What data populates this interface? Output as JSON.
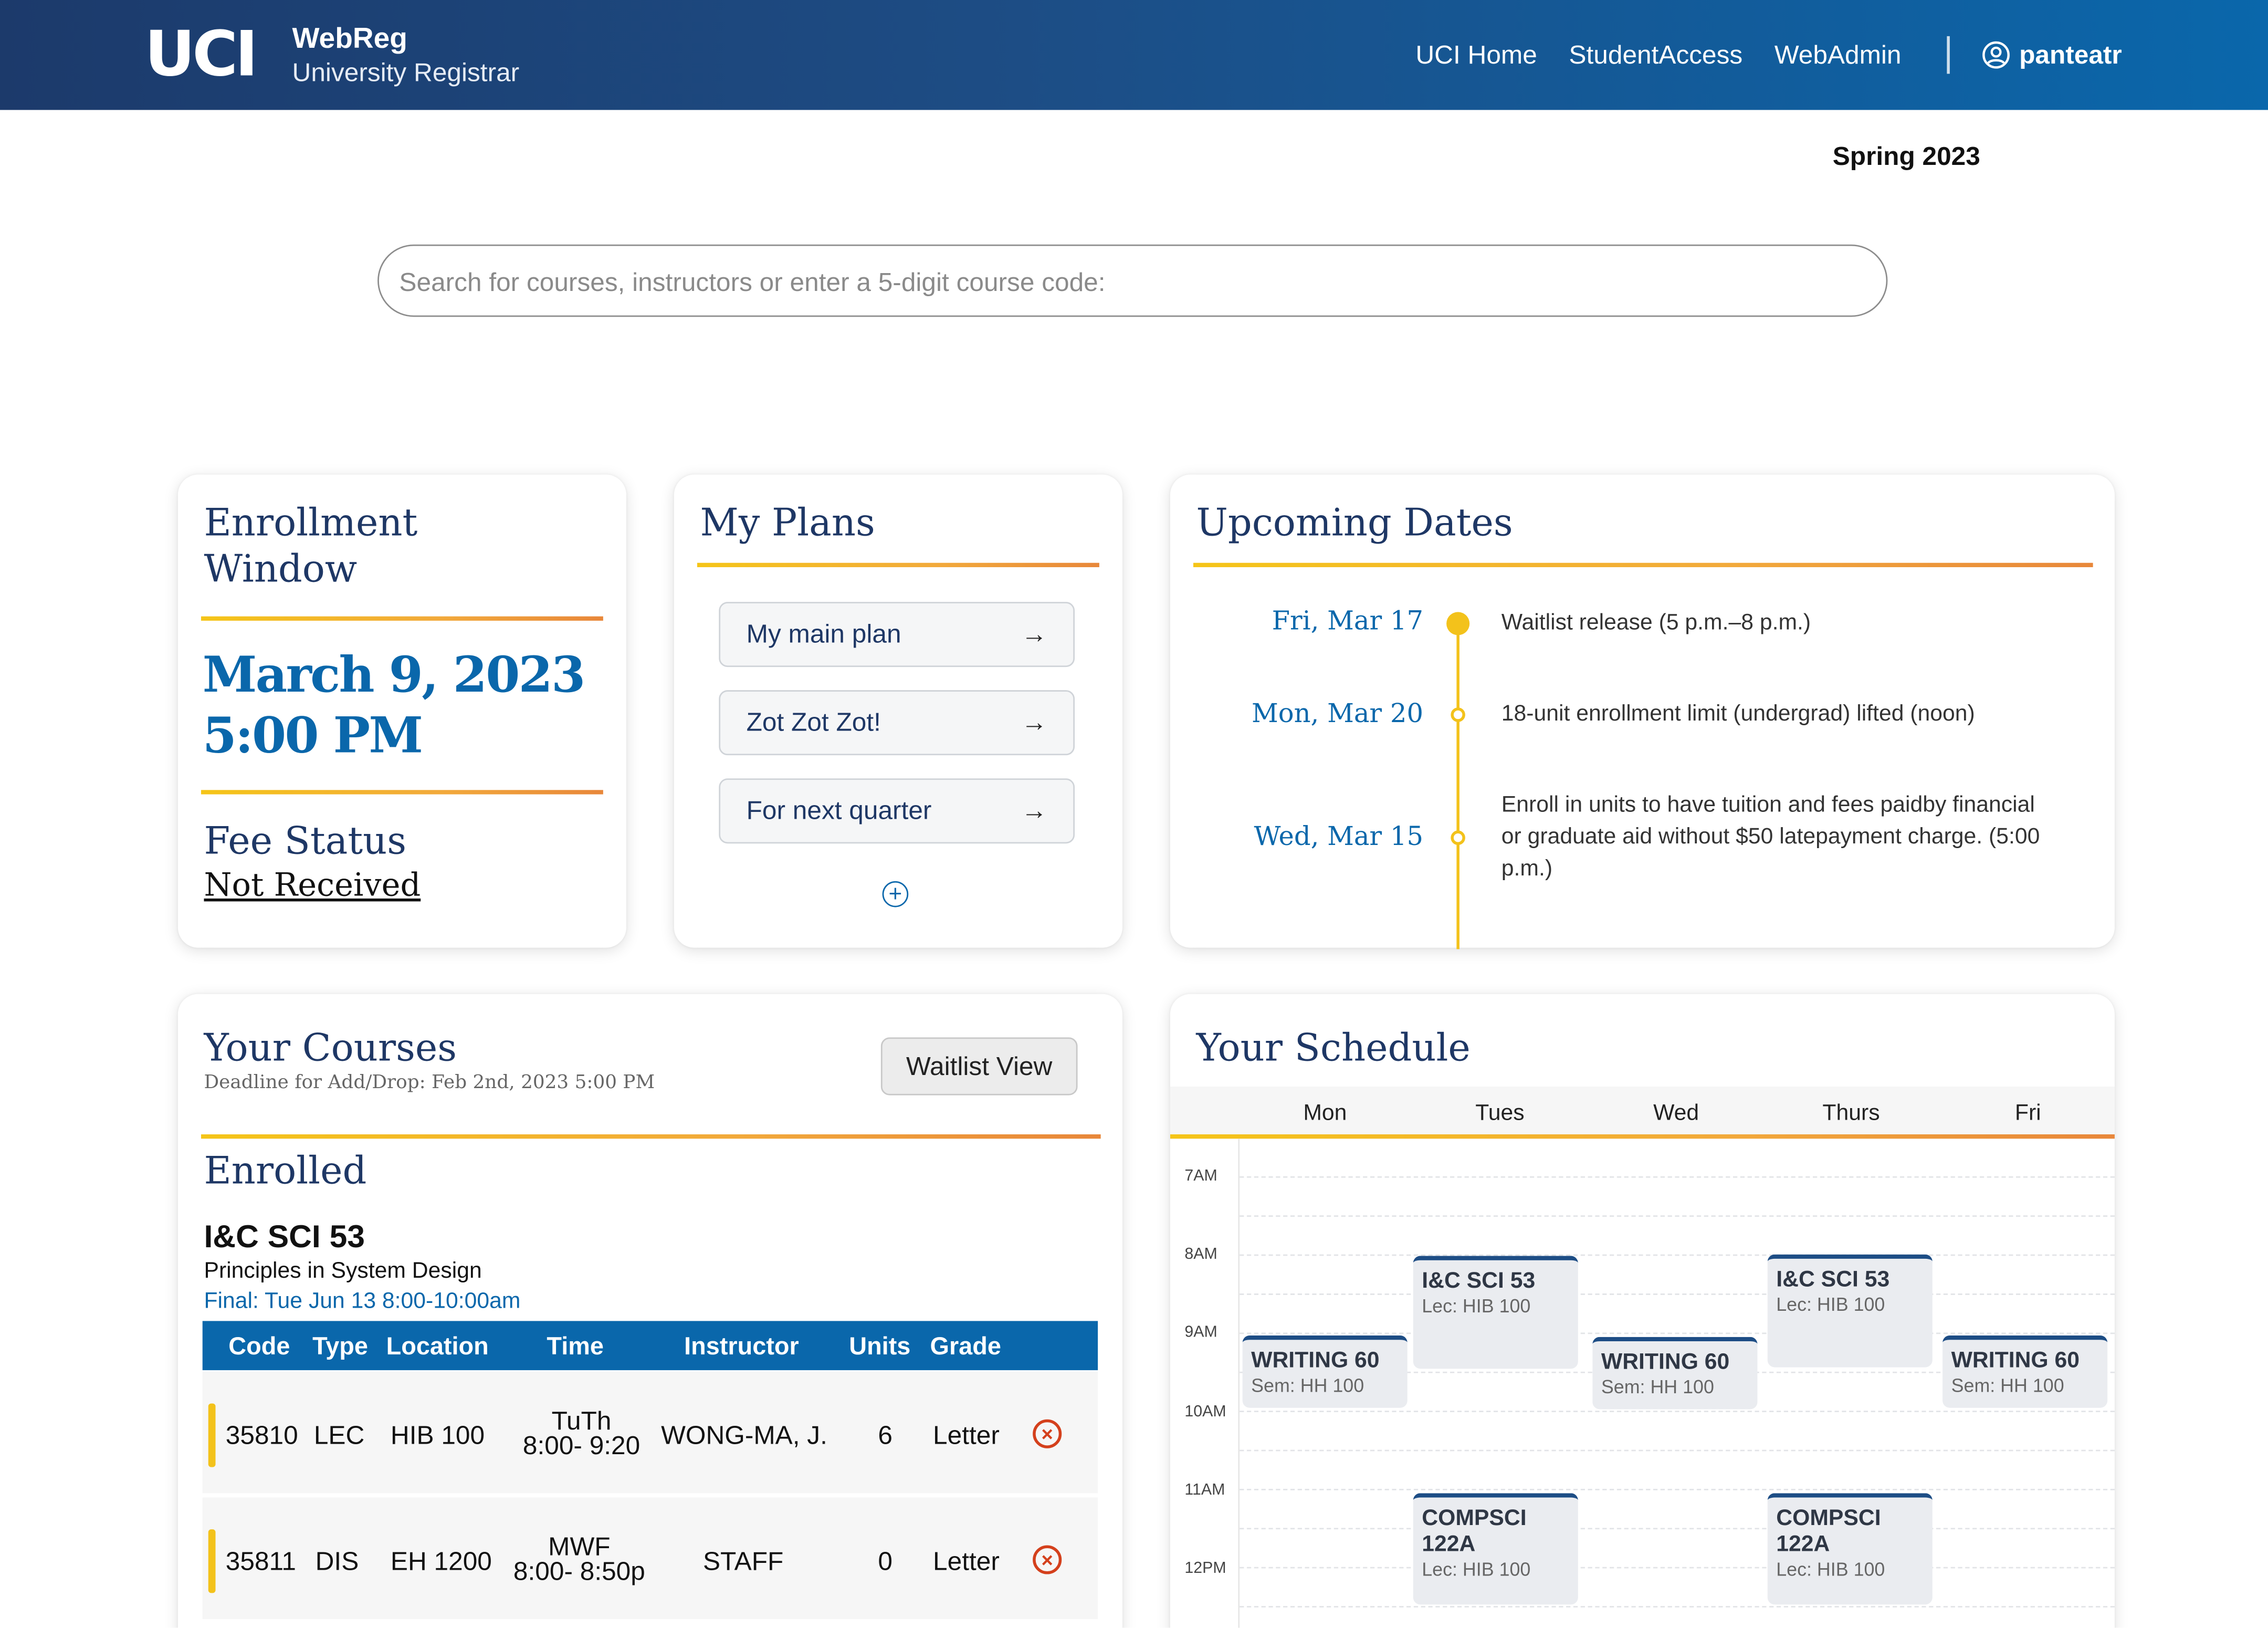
{
  "header": {
    "logo": "UCI",
    "brand_title": "WebReg",
    "brand_sub": "University Registrar",
    "nav": [
      "UCI Home",
      "StudentAccess",
      "WebAdmin"
    ],
    "user": "panteatr"
  },
  "term": "Spring 2023",
  "search": {
    "placeholder": "Search for courses, instructors or enter a 5-digit course code:"
  },
  "enrollment": {
    "title": "Enrollment Window",
    "date": "March 9, 2023",
    "time": "5:00 PM",
    "fee_title": "Fee Status",
    "fee_status": "Not Received"
  },
  "plans": {
    "title": "My Plans",
    "items": [
      {
        "label": "My main plan"
      },
      {
        "label": "Zot Zot Zot!"
      },
      {
        "label": "For next quarter"
      }
    ]
  },
  "upcoming": {
    "title": "Upcoming Dates",
    "items": [
      {
        "date": "Fri, Mar 17",
        "text": "Waitlist release (5 p.m.–8 p.m.)"
      },
      {
        "date": "Mon, Mar 20",
        "text": "18-unit enrollment limit (undergrad) lifted (noon)"
      },
      {
        "date": "Wed, Mar 15",
        "text": "Enroll in units to have tuition and fees paidby financial or graduate aid without $50 latepayment charge. (5:00 p.m.)"
      }
    ]
  },
  "courses": {
    "title": "Your Courses",
    "deadline": "Deadline for Add/Drop: Feb 2nd, 2023 5:00 PM",
    "waitlist_button": "Waitlist View",
    "section_title": "Enrolled",
    "course": {
      "code": "I&C SCI 53",
      "name": "Principles in System Design",
      "final": "Final: Tue Jun 13 8:00-10:00am"
    },
    "columns": [
      "Code",
      "Type",
      "Location",
      "Time",
      "Instructor",
      "Units",
      "Grade"
    ],
    "rows": [
      {
        "code": "35810",
        "type": "LEC",
        "location": "HIB 100",
        "days": "TuTh",
        "time": "8:00- 9:20",
        "instructor": "WONG-MA, J.",
        "units": "6",
        "grade": "Letter"
      },
      {
        "code": "35811",
        "type": "DIS",
        "location": "EH 1200",
        "days": "MWF",
        "time": "8:00- 8:50p",
        "instructor": "STAFF",
        "units": "0",
        "grade": "Letter"
      }
    ]
  },
  "schedule": {
    "title": "Your Schedule",
    "days": [
      "Mon",
      "Tues",
      "Wed",
      "Thurs",
      "Fri"
    ],
    "hours": [
      "7AM",
      "8AM",
      "9AM",
      "10AM",
      "11AM",
      "12PM"
    ],
    "events": [
      {
        "title": "WRITING 60",
        "sub": "Sem: HH 100",
        "day": "Mon"
      },
      {
        "title": "I&C SCI 53",
        "sub": "Lec: HIB 100",
        "day": "Tues"
      },
      {
        "title": "WRITING 60",
        "sub": "Sem: HH 100",
        "day": "Wed"
      },
      {
        "title": "I&C SCI 53",
        "sub": "Lec: HIB 100",
        "day": "Thurs"
      },
      {
        "title": "WRITING 60",
        "sub": "Sem: HH 100",
        "day": "Fri"
      },
      {
        "title": "COMPSCI 122A",
        "sub": "Lec: HIB 100",
        "day": "Tues"
      },
      {
        "title": "COMPSCI 122A",
        "sub": "Lec: HIB 100",
        "day": "Thurs"
      }
    ]
  },
  "colors": {
    "header_start": "#1c3a6b",
    "header_end": "#0a67ab",
    "accent_blue": "#0a67ab",
    "navy": "#1e3765",
    "gold": "#f5c518",
    "orange": "#e8873a",
    "drop_red": "#d4401c"
  }
}
